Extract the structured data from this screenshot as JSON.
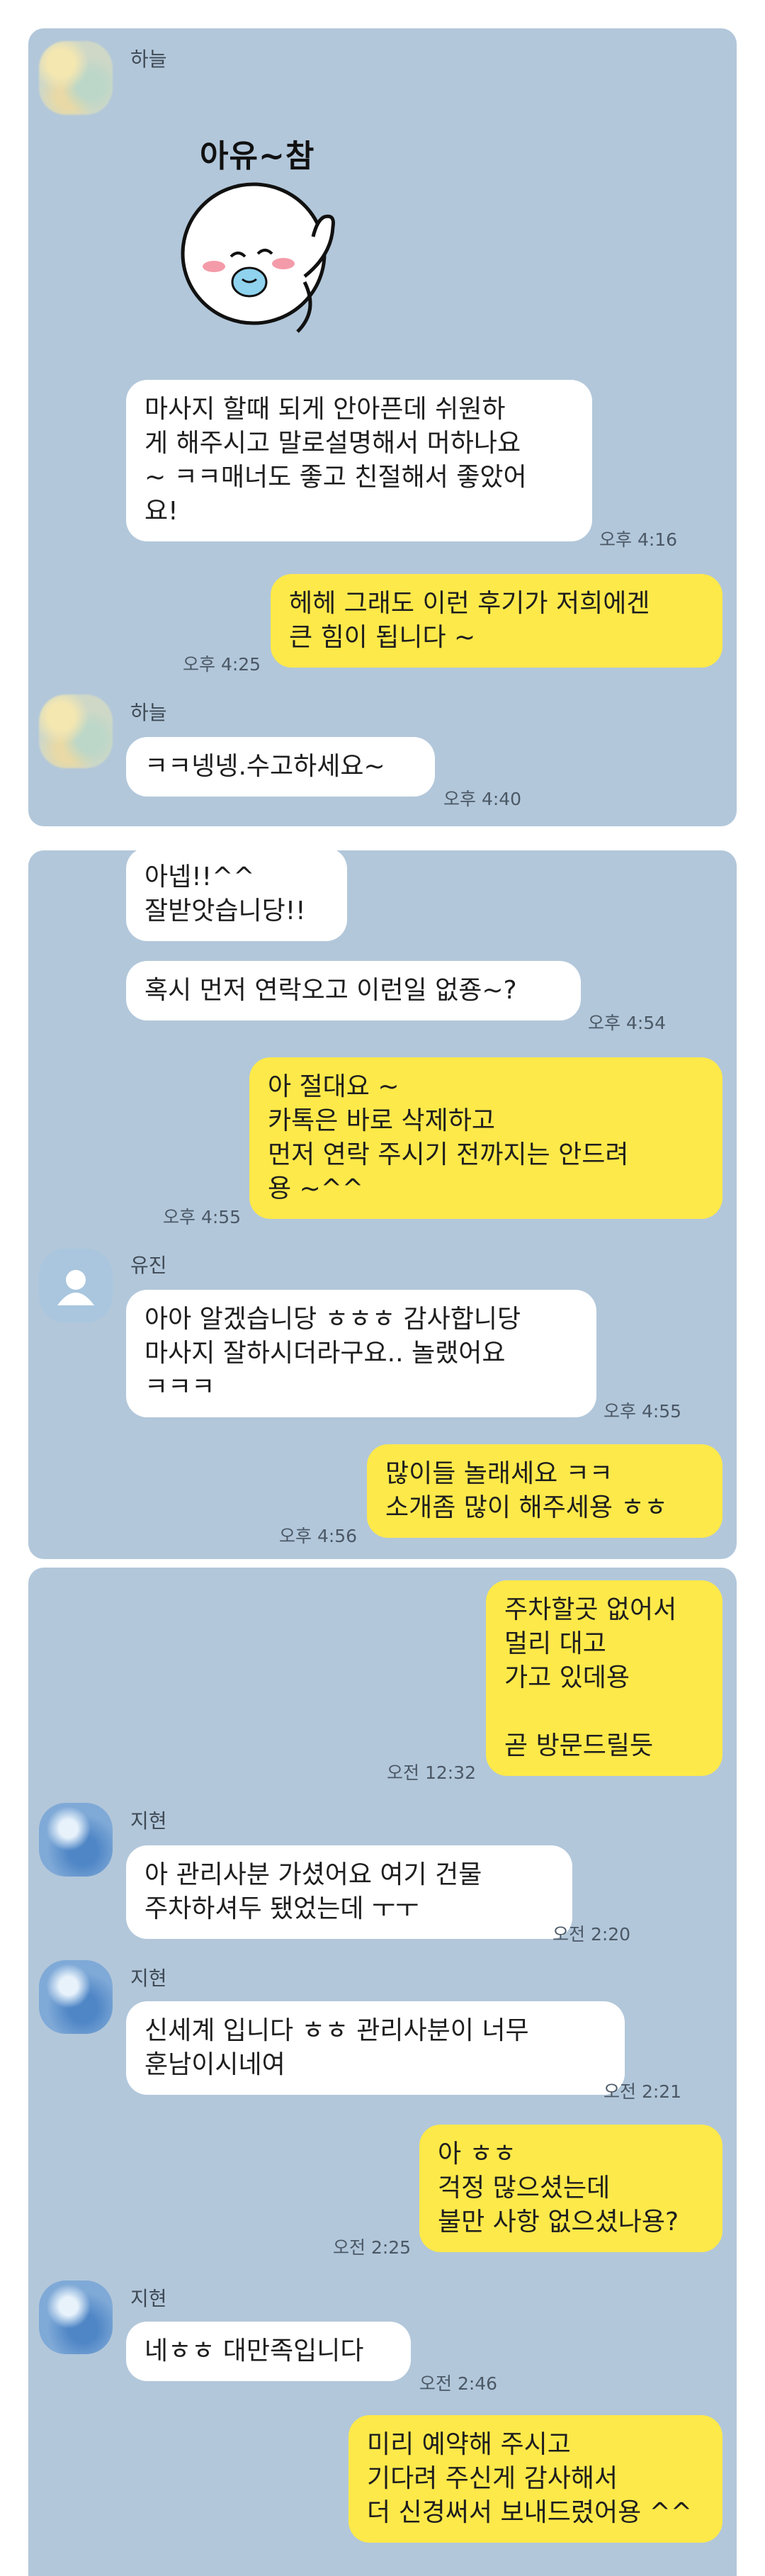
{
  "panel1": {
    "sender_name": "하늘",
    "sticker_caption": "아유~참",
    "msg1": "마사지 할때 되게 안아픈데 쉬원하\n게 해주시고 말로설명해서 머하나요\n~ ㅋㅋ매너도 좋고 친절해서 좋았어\n요!",
    "time1": "오후 4:16",
    "reply1": "헤헤 그래도 이런 후기가 저희에겐\n큰 힘이 됩니다 ~",
    "time_reply1": "오후 4:25",
    "sender_name2": "하늘",
    "msg2": "ㅋㅋ넹넹.수고하세요~",
    "time2": "오후 4:40"
  },
  "panel2": {
    "msg1": "아넵!!^^\n잘받앗습니당!!",
    "msg2": "혹시 먼저 연락오고 이런일 없죵~?",
    "time2": "오후 4:54",
    "reply1": "아 절대요 ~\n카톡은 바로 삭제하고\n먼저 연락 주시기 전까지는 안드려\n용 ~^^",
    "time_reply1": "오후 4:55",
    "sender_name": "유진",
    "msg3": "아아 알겠습니당 ㅎㅎㅎ 감사합니당\n마사지 잘하시더라구요.. 놀랬어요\nㅋㅋㅋ",
    "time3": "오후 4:55",
    "reply2": "많이들 놀래세요 ㅋㅋ\n소개좀 많이 해주세용 ㅎㅎ",
    "time_reply2": "오후 4:56"
  },
  "panel3": {
    "reply1": "주차할곳 없어서\n멀리 대고\n가고 있데용\n\n곧 방문드릴듯",
    "time_reply1": "오전 12:32",
    "sender_name": "지현",
    "msg1": "아 관리사분 가셨어요 여기 건물\n주차하셔두 됐었는데 ㅜㅜ",
    "time1": "오전 2:20",
    "sender_name2": "지현",
    "msg2": "신세계 입니다 ㅎㅎ 관리사분이 너무\n훈남이시네여",
    "time2": "오전 2:21",
    "reply2": "아 ㅎㅎ\n걱정 많으셨는데\n불만 사항 없으셨나용?",
    "time_reply2": "오전 2:25",
    "sender_name3": "지현",
    "msg3": "네ㅎㅎ 대만족입니다",
    "time3": "오전 2:46",
    "reply3": "미리 예약해 주시고\n기다려 주신게 감사해서\n더 신경써서 보내드렸어용 ^^"
  }
}
